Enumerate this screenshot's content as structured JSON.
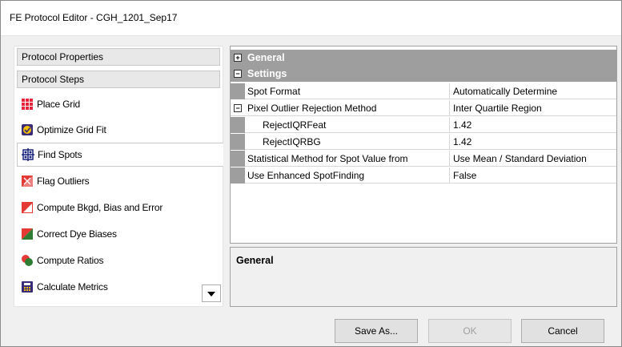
{
  "window": {
    "title": "FE Protocol Editor - CGH_1201_Sep17"
  },
  "nav": {
    "protocol_properties": "Protocol Properties",
    "protocol_steps": "Protocol Steps",
    "steps": [
      {
        "label": "Place Grid",
        "icon": "place-grid-icon",
        "selected": false
      },
      {
        "label": "Optimize Grid Fit",
        "icon": "optimize-grid-icon",
        "selected": false
      },
      {
        "label": "Find Spots",
        "icon": "find-spots-icon",
        "selected": true
      },
      {
        "label": "Flag Outliers",
        "icon": "flag-outliers-icon",
        "selected": false
      },
      {
        "label": "Compute Bkgd, Bias and Error",
        "icon": "compute-bkgd-icon",
        "selected": false
      },
      {
        "label": "Correct Dye Biases",
        "icon": "correct-dye-icon",
        "selected": false
      },
      {
        "label": "Compute Ratios",
        "icon": "compute-ratios-icon",
        "selected": false
      },
      {
        "label": "Calculate Metrics",
        "icon": "calculate-metrics-icon",
        "selected": false
      }
    ]
  },
  "grid": {
    "categories": {
      "general": {
        "label": "General",
        "expanded": false,
        "toggle": "+"
      },
      "settings": {
        "label": "Settings",
        "expanded": true,
        "toggle": "−"
      }
    },
    "rows": [
      {
        "name": "Spot Format",
        "value": "Automatically Determine"
      },
      {
        "name": "Pixel Outlier Rejection Method",
        "value": "Inter Quartile Region",
        "toggle": "−"
      },
      {
        "name": "RejectIQRFeat",
        "value": "1.42"
      },
      {
        "name": "RejectIQRBG",
        "value": "1.42"
      },
      {
        "name": "Statistical Method for Spot Value from",
        "value": "Use Mean / Standard Deviation"
      },
      {
        "name": "Use Enhanced SpotFinding",
        "value": "False"
      }
    ]
  },
  "description": {
    "title": "General"
  },
  "buttons": {
    "save_as": "Save As...",
    "ok": "OK",
    "cancel": "Cancel"
  },
  "colors": {
    "category_bg": "#9e9e9e",
    "selected_border": "#c8c8c8"
  }
}
